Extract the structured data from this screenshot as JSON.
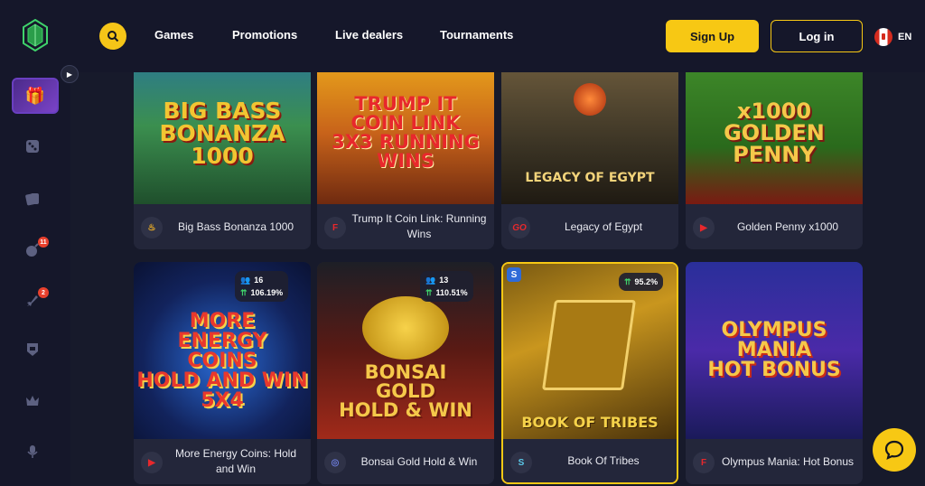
{
  "nav": {
    "games": "Games",
    "promotions": "Promotions",
    "live_dealers": "Live dealers",
    "tournaments": "Tournaments"
  },
  "auth": {
    "signup": "Sign Up",
    "login": "Log in"
  },
  "lang": {
    "code": "EN"
  },
  "sidebar": {
    "badges": {
      "bombs": "11",
      "rocket": "2"
    }
  },
  "games": [
    {
      "name": "Big Bass Bonanza 1000",
      "art": "BIG BASS\nBONANZA\n1000",
      "provider": "♨"
    },
    {
      "name": "Trump It Coin Link: Running Wins",
      "art": "TRUMP IT\nCOIN LINK\n3X3 RUNNING WINS",
      "provider": "F"
    },
    {
      "name": "Legacy of Egypt",
      "art": "LEGACY OF EGYPT",
      "provider": "GO"
    },
    {
      "name": "Golden Penny x1000",
      "art": "x1000\nGOLDEN\nPENNY",
      "provider": "▶"
    },
    {
      "name": "More Energy Coins: Hold and Win",
      "art": "MORE\nENERGY\nCOINS\nHOLD AND WIN 5X4",
      "provider": "▶",
      "players": "16",
      "rtp": "106.19%"
    },
    {
      "name": "Bonsai Gold Hold & Win",
      "art": "BONSAI\nGOLD\nHOLD & WIN",
      "provider": "◎",
      "players": "13",
      "rtp": "110.51%"
    },
    {
      "name": "Book Of Tribes",
      "art": "BOOK OF TRIBES",
      "provider": "S",
      "rtp": "95.2%"
    },
    {
      "name": "Olympus Mania: Hot Bonus",
      "art": "OLYMPUS\nMANIA\nHOT BONUS",
      "provider": "F"
    }
  ]
}
